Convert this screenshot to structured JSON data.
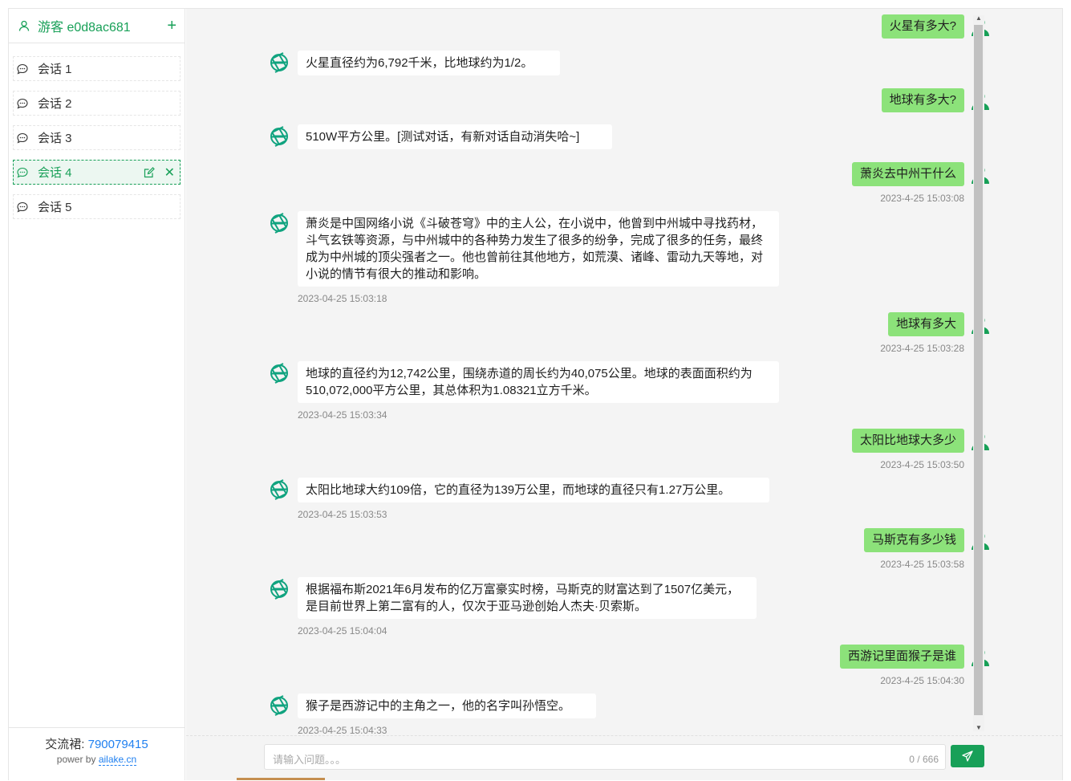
{
  "user": {
    "name": "游客 e0d8ac681",
    "add_icon": "plus-icon"
  },
  "sessions": [
    {
      "label": "会话 1"
    },
    {
      "label": "会话 2"
    },
    {
      "label": "会话 3"
    },
    {
      "label": "会话 4",
      "active": true
    },
    {
      "label": "会话 5"
    }
  ],
  "footer": {
    "qq_label": "交流裙:",
    "qq_number": "790079415",
    "power_prefix": "power by",
    "power_link": "ailake.cn"
  },
  "messages": [
    {
      "role": "user",
      "text": "火星有多大?"
    },
    {
      "role": "bot",
      "text": "火星直径约为6,792千米，比地球约为1/2。"
    },
    {
      "role": "user",
      "text": "地球有多大?"
    },
    {
      "role": "bot",
      "text": "510W平方公里。[测试对话，有新对话自动消失哈~]"
    },
    {
      "role": "user",
      "text": "萧炎去中州干什么",
      "time": "2023-4-25 15:03:08"
    },
    {
      "role": "bot",
      "text": "萧炎是中国网络小说《斗破苍穹》中的主人公，在小说中，他曾到中州城中寻找药材，斗气玄铁等资源，与中州城中的各种势力发生了很多的纷争，完成了很多的任务，最终成为中州城的顶尖强者之一。他也曾前往其他地方，如荒漠、诸峰、雷动九天等地，对小说的情节有很大的推动和影响。",
      "time": "2023-04-25 15:03:18"
    },
    {
      "role": "user",
      "text": "地球有多大",
      "time": "2023-4-25 15:03:28"
    },
    {
      "role": "bot",
      "text": "地球的直径约为12,742公里，围绕赤道的周长约为40,075公里。地球的表面面积约为510,072,000平方公里，其总体积为1.08321立方千米。",
      "time": "2023-04-25 15:03:34"
    },
    {
      "role": "user",
      "text": "太阳比地球大多少",
      "time": "2023-4-25 15:03:50"
    },
    {
      "role": "bot",
      "text": "太阳比地球大约109倍，它的直径为139万公里，而地球的直径只有1.27万公里。",
      "time": "2023-04-25 15:03:53"
    },
    {
      "role": "user",
      "text": "马斯克有多少钱",
      "time": "2023-4-25 15:03:58"
    },
    {
      "role": "bot",
      "text": "根据福布斯2021年6月发布的亿万富豪实时榜，马斯克的财富达到了1507亿美元，是目前世界上第二富有的人，仅次于亚马逊创始人杰夫·贝索斯。",
      "time": "2023-04-25 15:04:04"
    },
    {
      "role": "user",
      "text": "西游记里面猴子是谁",
      "time": "2023-4-25 15:04:30"
    },
    {
      "role": "bot",
      "text": "猴子是西游记中的主角之一，他的名字叫孙悟空。",
      "time": "2023-04-25 15:04:33"
    }
  ],
  "input": {
    "placeholder": "请输入问题。。。",
    "counter": "0 / 666"
  },
  "colors": {
    "accent": "#18a058",
    "user_bubble": "#8ce27a",
    "link": "#2080f0"
  }
}
